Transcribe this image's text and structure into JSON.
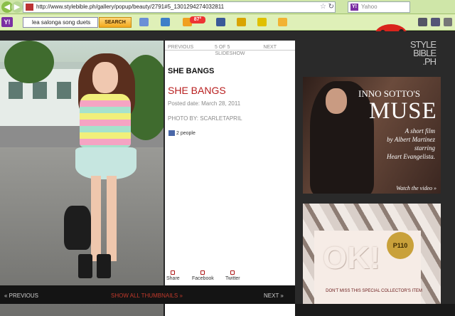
{
  "browser": {
    "url": "http://www.stylebible.ph/gallery/popup/beauty/2791#5_1301294274032811",
    "search_engine_placeholder": "Yahoo",
    "toolbar": {
      "search_query": "lea salonga song duets",
      "search_button": "SEARCH",
      "badge_count": "87°"
    }
  },
  "gallery": {
    "pager": {
      "prev": "PREVIOUS",
      "count": "5 OF 5",
      "next": "NEXT",
      "mode": "SLIDESHOW"
    },
    "title": "SHE BANGS",
    "title_red": "SHE BANGS",
    "posted": "Posted date: March 28, 2011",
    "photo_by": "PHOTO BY: SCARLETAPRIL",
    "likes": "2 people",
    "share": {
      "share": "Share",
      "facebook": "Facebook",
      "twitter": "Twitter"
    },
    "bottom": {
      "prev": "« PREVIOUS",
      "thumbnails": "SHOW ALL THUMBNAILS »",
      "next": "NEXT »"
    }
  },
  "site": {
    "logo_lines": [
      "STYLE",
      "BIBLE",
      ".PH"
    ]
  },
  "ads": {
    "ad1": {
      "headline1": "INNO SOTTO'S",
      "headline2": "MUSE",
      "copy_lines": [
        "A short film",
        "by Albert Martinez",
        "starring",
        "Heart Evangelista."
      ],
      "watch": "Watch the video »"
    },
    "ad2": {
      "logo": "OK!",
      "medal": "P110",
      "copy": "DON'T MISS THIS SPECIAL COLLECTOR'S ITEM"
    }
  }
}
